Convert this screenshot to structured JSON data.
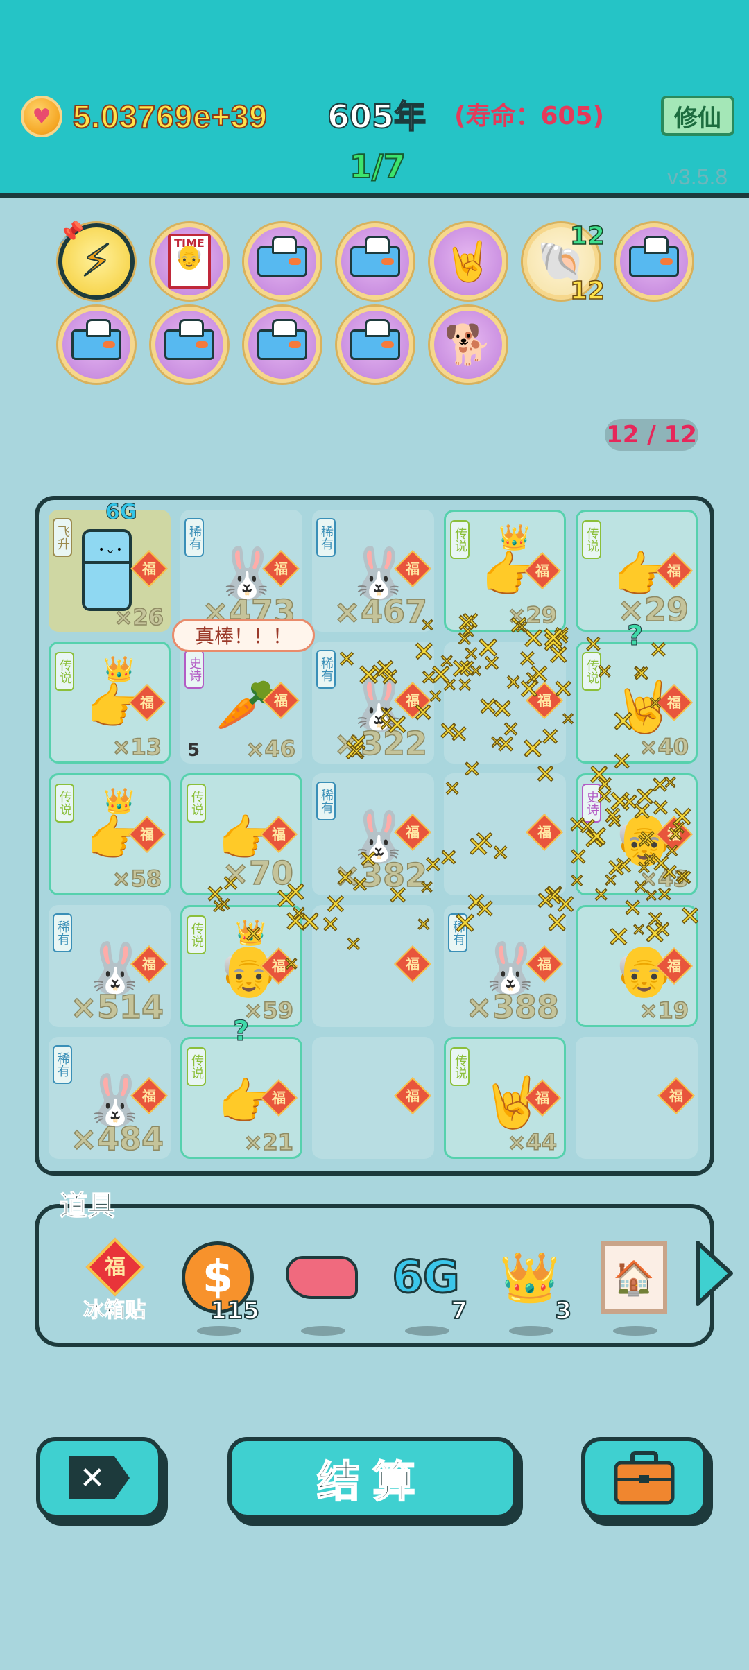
{
  "header": {
    "currency_icon": "heart-coin-icon",
    "currency": "5.03769e+39",
    "year": "605年",
    "lifespan": "(寿命：605)",
    "cultivate_button": "修仙",
    "stage": "1/7",
    "version": "v3.5.8"
  },
  "badges": {
    "icons": [
      "lightning-icon",
      "time-magazine-icon",
      "tissue-box-icon",
      "tissue-box-icon",
      "rock-hand-icon",
      "shell-icon",
      "tissue-box-icon",
      "tissue-box-icon",
      "tissue-box-icon",
      "tissue-box-icon",
      "tissue-box-icon",
      "husky-dog-icon"
    ],
    "shell_count_top": "12",
    "shell_count_bottom": "12"
  },
  "capacity": "12 / 12",
  "speech_bubble": "真棒！！！",
  "board": {
    "rows": [
      [
        {
          "tag": "飞升",
          "item": "fridge",
          "mult": "×26",
          "extra": "6G"
        },
        {
          "tag": "稀有",
          "item": "bunny",
          "mult": "×473"
        },
        {
          "tag": "稀有",
          "item": "bunny",
          "mult": "×467"
        },
        {
          "tag": "传说",
          "item": "crown-point-hand",
          "mult": "×29"
        },
        {
          "tag": "传说",
          "item": "point-hand",
          "mult": "×29"
        }
      ],
      [
        {
          "tag": "传说",
          "item": "crown-point-hand",
          "mult": "×13"
        },
        {
          "tag": "史诗",
          "item": "carrot",
          "mult": "×46",
          "level": "5"
        },
        {
          "tag": "稀有",
          "item": "bunny",
          "mult": "×322"
        },
        {
          "tag": "",
          "item": "",
          "mult": ""
        },
        {
          "tag": "传说",
          "item": "rock-hand",
          "mult": "×40"
        }
      ],
      [
        {
          "tag": "传说",
          "item": "crown-point-hand",
          "mult": "×58"
        },
        {
          "tag": "传说",
          "item": "point-hand",
          "mult": "×70"
        },
        {
          "tag": "稀有",
          "item": "bunny",
          "mult": "×382"
        },
        {
          "tag": "",
          "item": "",
          "mult": ""
        },
        {
          "tag": "史诗",
          "item": "grandpa",
          "mult": "×43"
        }
      ],
      [
        {
          "tag": "稀有",
          "item": "bunny",
          "mult": "×514"
        },
        {
          "tag": "传说",
          "item": "crown-grandpa",
          "mult": "×59"
        },
        {
          "tag": "",
          "item": "",
          "mult": ""
        },
        {
          "tag": "稀有",
          "item": "bunny",
          "mult": "×388"
        },
        {
          "tag": "",
          "item": "grandpa",
          "mult": "×19"
        }
      ],
      [
        {
          "tag": "稀有",
          "item": "bunny",
          "mult": "×484"
        },
        {
          "tag": "传说",
          "item": "point-hand",
          "mult": "×21"
        },
        {
          "tag": "",
          "item": "",
          "mult": ""
        },
        {
          "tag": "传说",
          "item": "rock-hand",
          "mult": "×44"
        },
        {
          "tag": "",
          "item": "",
          "mult": ""
        }
      ]
    ],
    "fu_label": "福"
  },
  "tools": {
    "label": "道具",
    "items": [
      {
        "icon": "fu-diamond-icon",
        "name": "冰箱贴",
        "qty": ""
      },
      {
        "icon": "dollar-coin-icon",
        "name": "",
        "qty": "115"
      },
      {
        "icon": "liver-icon",
        "name": "",
        "qty": ""
      },
      {
        "icon": "6g-icon",
        "name": "6G",
        "qty": "7"
      },
      {
        "icon": "crown-icon",
        "name": "",
        "qty": "3"
      },
      {
        "icon": "framed-picture-icon",
        "name": "",
        "qty": ""
      }
    ]
  },
  "buttons": {
    "close_icon": "close-x-icon",
    "settle": "结算",
    "bag_icon": "briefcase-icon"
  },
  "colors": {
    "header_bg": "#25c4c6",
    "body_bg": "#a9d6dd",
    "accent_gold": "#ffe24a",
    "lifespan_red": "#e43a5a",
    "stage_green": "#3de46d"
  }
}
